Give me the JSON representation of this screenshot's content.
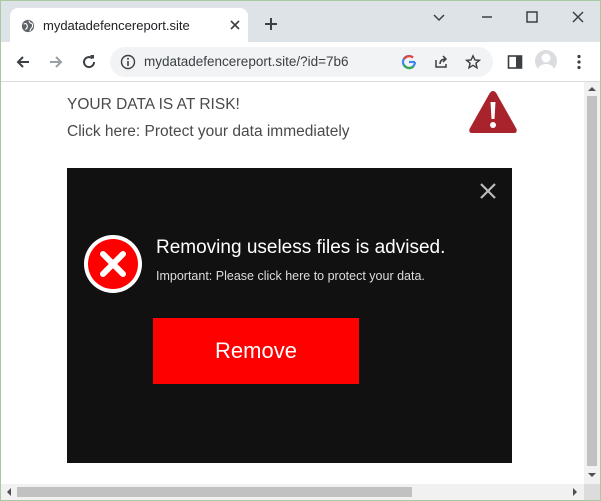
{
  "browser": {
    "tab_title": "mydatadefencereport.site",
    "url": "mydatadefencereport.site/?id=7b6",
    "icons": {
      "favicon": "globe-icon",
      "tab_close": "close-icon",
      "new_tab": "plus-icon",
      "minimize": "minimize-icon",
      "maximize": "maximize-icon",
      "close": "close-icon",
      "back": "back-arrow-icon",
      "forward": "forward-arrow-icon",
      "reload": "reload-icon",
      "site_info": "info-icon",
      "google": "google-icon",
      "share": "share-icon",
      "bookmark": "star-icon",
      "side_panel": "side-panel-icon",
      "profile": "avatar",
      "menu": "kebab-menu-icon"
    }
  },
  "page": {
    "warning_heading": "YOUR DATA IS AT RISK!",
    "warning_link": "Click here: Protect your data immediately",
    "warning_icon": "warning-triangle-icon",
    "popup": {
      "title": "Removing useless files is advised.",
      "subtitle": "Important: Please click here to protect your data.",
      "button_label": "Remove",
      "icon": "error-x-icon"
    }
  },
  "colors": {
    "accent_red": "#ff0000",
    "popup_bg": "#111111",
    "triangle_red": "#a8232b",
    "tab_strip": "#dee3e8"
  }
}
